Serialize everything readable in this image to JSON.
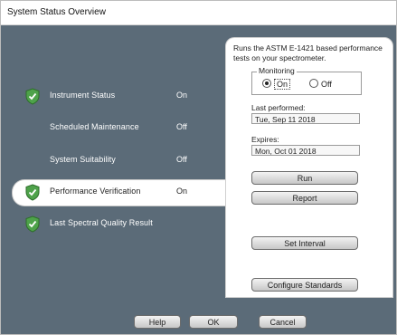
{
  "window": {
    "title": "System Status Overview"
  },
  "sidebar": {
    "items": [
      {
        "label": "Instrument Status",
        "value": "On",
        "shield": true,
        "selected": false
      },
      {
        "label": "Scheduled Maintenance",
        "value": "Off",
        "shield": false,
        "selected": false
      },
      {
        "label": "System Suitability",
        "value": "Off",
        "shield": false,
        "selected": false
      },
      {
        "label": "Performance Verification",
        "value": "On",
        "shield": true,
        "selected": true
      },
      {
        "label": "Last Spectral Quality Result",
        "value": "",
        "shield": true,
        "selected": false
      }
    ]
  },
  "panel": {
    "description": "Runs the ASTM E-1421 based performance tests on your spectrometer.",
    "monitoring": {
      "label": "Monitoring",
      "on_label": "On",
      "off_label": "Off",
      "selected": "On"
    },
    "last_performed": {
      "label": "Last performed:",
      "value": "Tue, Sep 11 2018"
    },
    "expires": {
      "label": "Expires:",
      "value": "Mon, Oct 01 2018"
    },
    "run_label": "Run",
    "report_label": "Report",
    "set_interval_label": "Set Interval",
    "configure_standards_label": "Configure Standards"
  },
  "footer": {
    "help_label": "Help",
    "ok_label": "OK",
    "cancel_label": "Cancel"
  },
  "colors": {
    "sidebar_bg": "#5b6b78",
    "shield_green": "#4ea24a"
  }
}
